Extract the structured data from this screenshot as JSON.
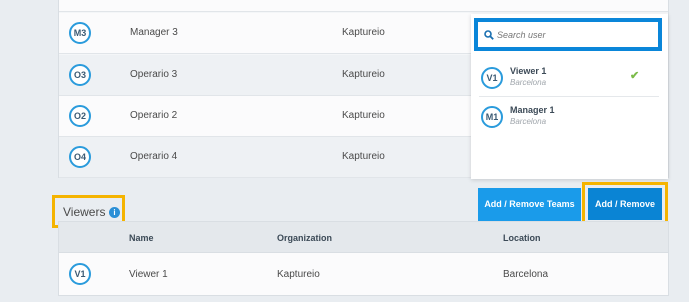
{
  "users": [
    {
      "initials": "M3",
      "name": "Manager 3",
      "org": "Kaptureio"
    },
    {
      "initials": "O3",
      "name": "Operario 3",
      "org": "Kaptureio"
    },
    {
      "initials": "O2",
      "name": "Operario 2",
      "org": "Kaptureio"
    },
    {
      "initials": "O4",
      "name": "Operario 4",
      "org": "Kaptureio"
    }
  ],
  "dropdown": {
    "search_placeholder": "Search user",
    "items": [
      {
        "initials": "V1",
        "name": "Viewer 1",
        "location": "Barcelona",
        "selected": true
      },
      {
        "initials": "M1",
        "name": "Manager 1",
        "location": "Barcelona",
        "selected": false
      }
    ],
    "check_glyph": "✔"
  },
  "buttons": {
    "teams": "Add / Remove Teams",
    "add_remove": "Add / Remove"
  },
  "viewers": {
    "title": "Viewers",
    "info_glyph": "i",
    "columns": {
      "name": "Name",
      "organization": "Organization",
      "location": "Location"
    },
    "rows": [
      {
        "initials": "V1",
        "name": "Viewer 1",
        "org": "Kaptureio",
        "location": "Barcelona"
      }
    ]
  },
  "colors": {
    "accent": "#0a84d4",
    "highlight": "#f5b400",
    "check": "#7cbb4a"
  }
}
